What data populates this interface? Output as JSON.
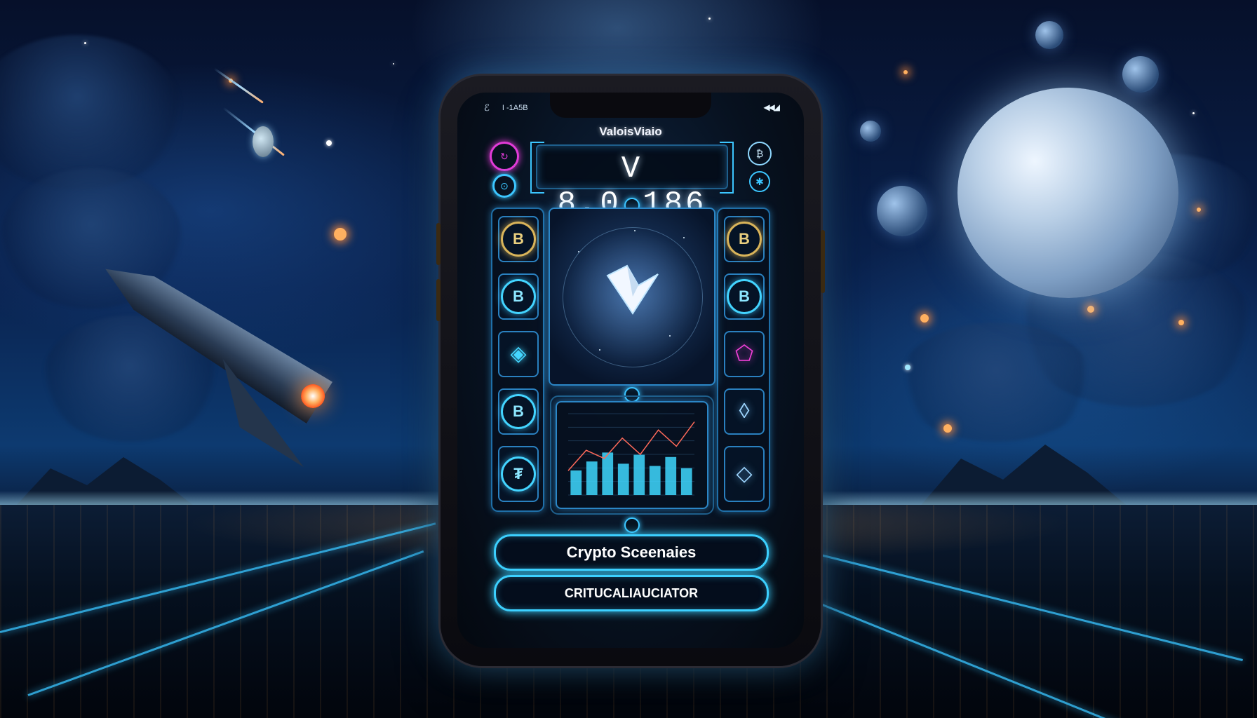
{
  "status_bar": {
    "left_icon": "cell-icon",
    "left_text": "I -1A5B",
    "right_icons": "signal-battery-icon"
  },
  "app": {
    "name": "ValoisViaio",
    "value_display": "V 8,0.186"
  },
  "left_column": [
    {
      "icon": "bitcoin-coin-icon",
      "glyph": "B",
      "style": "gold"
    },
    {
      "icon": "bitcoin-coin-icon",
      "glyph": "B",
      "style": "cyan"
    },
    {
      "icon": "diamond-crypto-icon",
      "glyph": "◈",
      "style": "cyan"
    },
    {
      "icon": "bitcoin-coin-icon",
      "glyph": "B",
      "style": "cyan"
    },
    {
      "icon": "tether-coin-icon",
      "glyph": "₮",
      "style": "cyan"
    }
  ],
  "right_column": [
    {
      "icon": "bitcoin-coin-icon",
      "glyph": "B",
      "style": "gold"
    },
    {
      "icon": "bitcoin-coin-icon",
      "glyph": "B",
      "style": "cyan"
    },
    {
      "icon": "pentagon-crypto-icon",
      "glyph": "⬠",
      "style": "pink"
    },
    {
      "icon": "ethereum-icon",
      "glyph": "◊",
      "style": "blue"
    },
    {
      "icon": "crystal-crypto-icon",
      "glyph": "◇",
      "style": "blue"
    }
  ],
  "chart_data": {
    "type": "bar",
    "bars": [
      0.55,
      0.75,
      0.95,
      0.7,
      0.9,
      0.65,
      0.85,
      0.6
    ],
    "line": [
      0.3,
      0.55,
      0.45,
      0.7,
      0.5,
      0.8,
      0.6,
      0.9
    ]
  },
  "buttons": {
    "primary": "Crypto Sceenaies",
    "secondary": "CRITUCALIAUCIATOR"
  },
  "colors": {
    "accent": "#3cd0ff",
    "pink": "#e23bd8",
    "gold": "#d9b45a"
  }
}
